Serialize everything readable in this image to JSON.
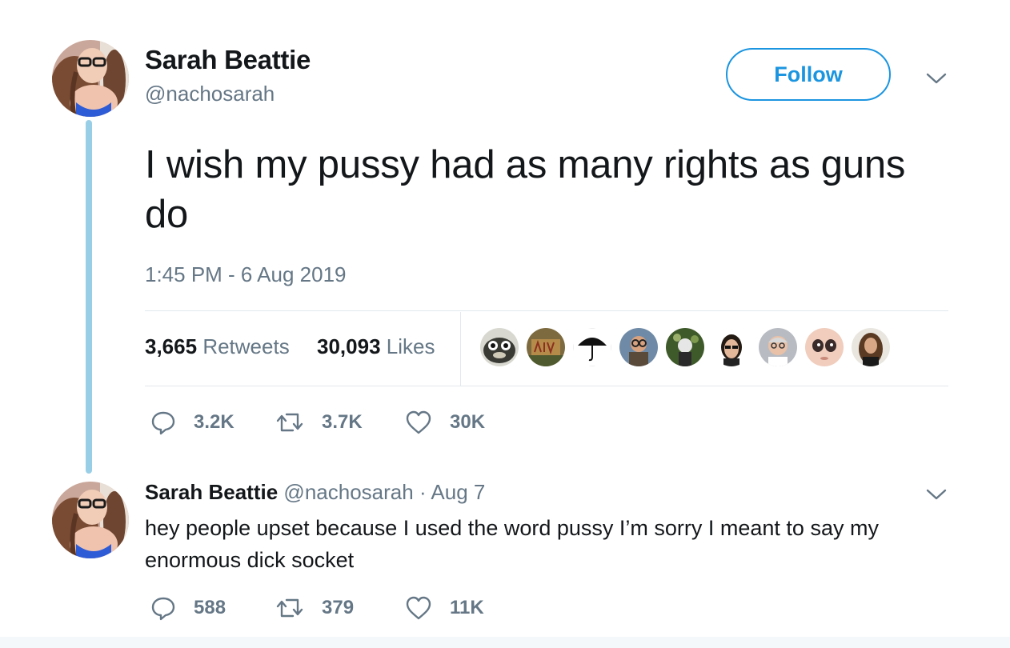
{
  "tweet": {
    "author_name": "Sarah Beattie",
    "author_handle": "@nachosarah",
    "follow_label": "Follow",
    "text": "I wish my pussy had as many rights as guns do",
    "timestamp": "1:45 PM - 6 Aug 2019",
    "retweets_count": "3,665",
    "retweets_label": "Retweets",
    "likes_count": "30,093",
    "likes_label": "Likes",
    "actions": {
      "replies": "3.2K",
      "retweets": "3.7K",
      "likes": "30K"
    }
  },
  "reply": {
    "author_name": "Sarah Beattie",
    "author_handle": "@nachosarah",
    "separator": "·",
    "date": "Aug 7",
    "text": "hey people upset because I used the word pussy I’m sorry I meant to say my enormous dick socket",
    "actions": {
      "replies": "588",
      "retweets": "379",
      "likes": "11K"
    }
  },
  "icons": {
    "reply": "speech-bubble-icon",
    "retweet": "retweet-arrows-icon",
    "like": "heart-icon",
    "menu": "chevron-down-icon"
  },
  "colors": {
    "accent": "#1b95e0",
    "thread_line": "#99cfe6",
    "muted_text": "#657786",
    "primary_text": "#14171a",
    "divider": "#e1e8ed"
  }
}
